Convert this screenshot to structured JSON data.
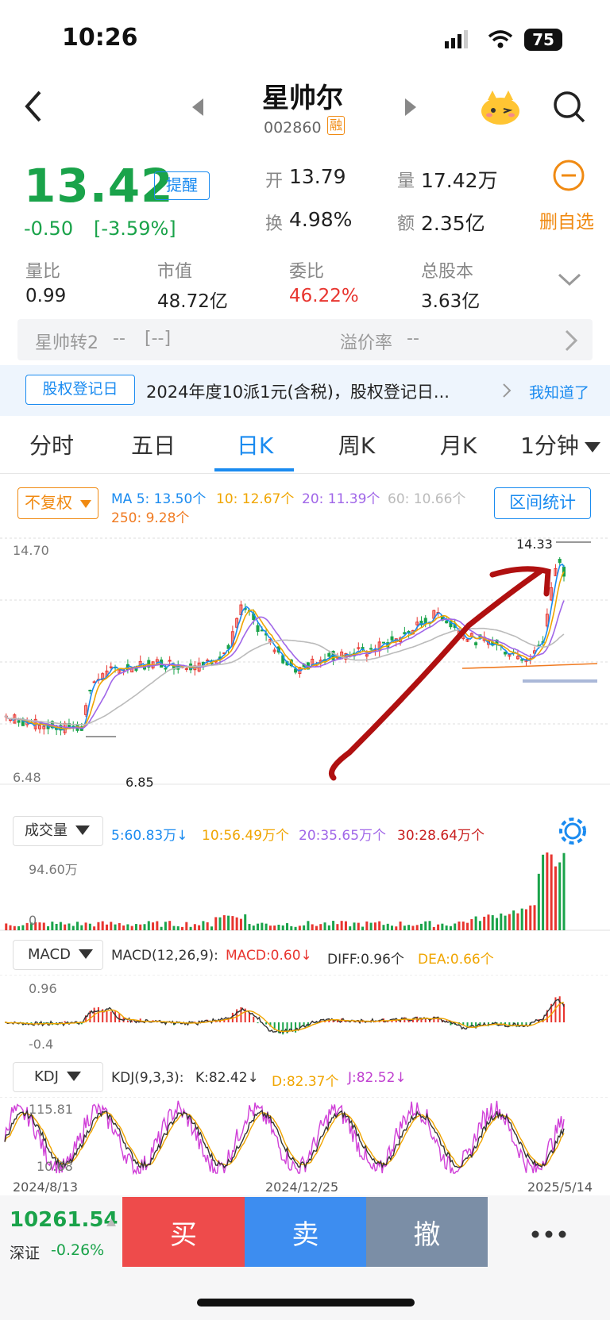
{
  "status_bar": {
    "time": "10:26",
    "battery": "75"
  },
  "header": {
    "stock_name": "星帅尔",
    "stock_code": "002860",
    "margin_badge": "融"
  },
  "quote": {
    "price": "13.42",
    "change": "-0.50",
    "change_pct": "[-3.59%]",
    "alert_label": "提醒",
    "open_label": "开",
    "open": "13.79",
    "volume_label": "量",
    "volume": "17.42万",
    "turnover_label": "换",
    "turnover": "4.98%",
    "amount_label": "额",
    "amount": "2.35亿",
    "remove_watch_label": "删自选"
  },
  "stats": [
    {
      "label": "量比",
      "value": "0.99"
    },
    {
      "label": "市值",
      "value": "48.72亿"
    },
    {
      "label": "委比",
      "value": "46.22%"
    },
    {
      "label": "总股本",
      "value": "3.63亿"
    }
  ],
  "convertible": {
    "name": "星帅转2",
    "price": "--",
    "pct": "[--]",
    "premium_label": "溢价率",
    "premium": "--"
  },
  "notice": {
    "badge": "股权登记日",
    "text": "2024年度10派1元(含税)，股权登记日...",
    "dismiss": "我知道了"
  },
  "tabs": [
    "分时",
    "五日",
    "日K",
    "周K",
    "月K",
    "1分钟"
  ],
  "chart_controls": {
    "adjust": "不复权",
    "range_stats": "区间统计",
    "ma_labels": [
      "MA 5: 13.50个",
      "10: 12.67个",
      "20: 11.39个",
      "60: 10.66个",
      "250: 9.28个"
    ]
  },
  "volume_panel": {
    "selector": "成交量",
    "labels": [
      "5:60.83万↓",
      "10:56.49万个",
      "20:35.65万个",
      "30:28.64万个"
    ],
    "top": "94.60万",
    "zero": "0"
  },
  "macd_panel": {
    "selector": "MACD",
    "params": "MACD(12,26,9):",
    "macd": "MACD:0.60↓",
    "diff": "DIFF:0.96个",
    "dea": "DEA:0.66个",
    "top": "0.96",
    "bottom": "-0.4"
  },
  "kdj_panel": {
    "selector": "KDJ",
    "params": "KDJ(9,3,3):",
    "k": "K:82.42↓",
    "d": "D:82.37个",
    "j": "J:82.52↓",
    "top": "115.81",
    "bottom": "10.68"
  },
  "axis": {
    "dates": [
      "2024/8/13",
      "2024/12/25",
      "2025/5/14"
    ]
  },
  "bottom_bar": {
    "index_value": "10261.54",
    "index_name": "深证",
    "index_change": "-0.26%",
    "buy": "买",
    "sell": "卖",
    "cancel": "撤"
  },
  "colors": {
    "up": "#e8352f",
    "down": "#1aa34a",
    "accent": "#1a8bf0",
    "orange": "#f08a12",
    "ma5": "#1a8bf0",
    "ma10": "#f0a500",
    "ma20": "#a066e8",
    "ma60": "#bbbbbb",
    "ma250": "#f07a20",
    "annotation": "#b01010"
  },
  "chart_data": {
    "type": "candlestick",
    "price_labels": {
      "left_top": "14.70",
      "left_bottom": "6.48",
      "high_marker": "14.33",
      "low_marker": "6.85"
    },
    "x_range": [
      "2024/8/13",
      "2025/5/14"
    ],
    "ma": {
      "ma5": 13.5,
      "ma10": 12.67,
      "ma20": 11.39,
      "ma60": 10.66,
      "ma250": 9.28
    },
    "volume_current": "17.42万",
    "macd": {
      "macd": 0.6,
      "diff": 0.96,
      "dea": 0.66
    },
    "kdj": {
      "k": 82.42,
      "d": 82.37,
      "j": 82.52
    }
  }
}
